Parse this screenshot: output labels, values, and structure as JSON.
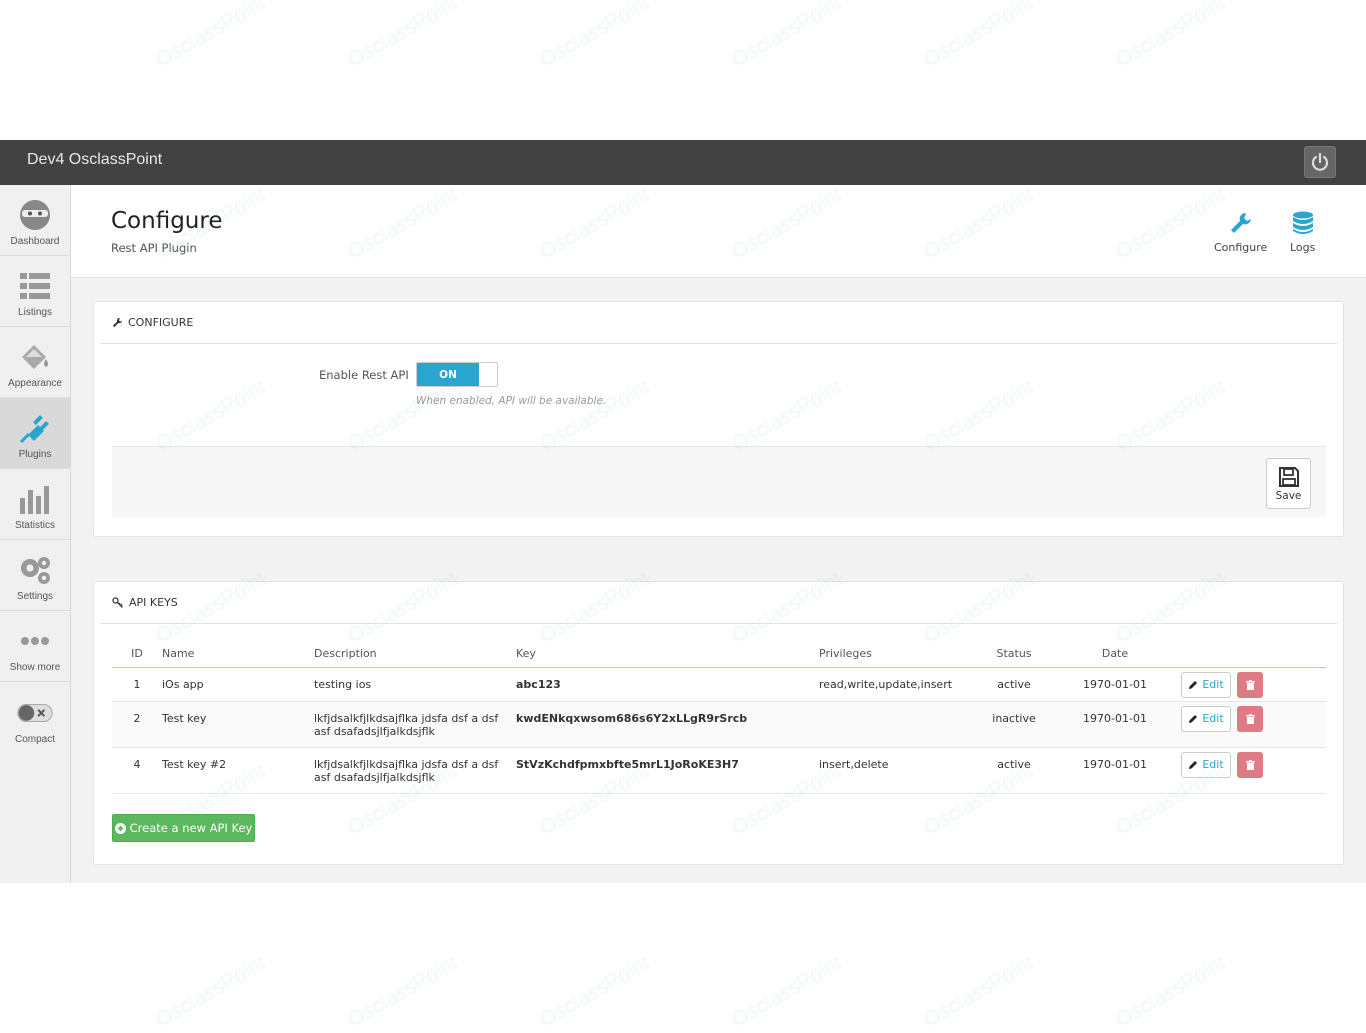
{
  "topbar": {
    "title": "Dev4 OsclassPoint"
  },
  "sidebar": {
    "items": [
      {
        "label": "Dashboard"
      },
      {
        "label": "Listings"
      },
      {
        "label": "Appearance"
      },
      {
        "label": "Plugins"
      },
      {
        "label": "Statistics"
      },
      {
        "label": "Settings"
      },
      {
        "label": "Show more"
      },
      {
        "label": "Compact"
      }
    ]
  },
  "header": {
    "title": "Configure",
    "subtitle": "Rest API Plugin",
    "links": [
      {
        "label": "Configure"
      },
      {
        "label": "Logs"
      }
    ]
  },
  "configure_panel": {
    "heading": "CONFIGURE",
    "enable_label": "Enable Rest API",
    "toggle_state": "ON",
    "hint": "When enabled, API will be available.",
    "save_label": "Save"
  },
  "api_keys_panel": {
    "heading": "API KEYS",
    "columns": [
      "ID",
      "Name",
      "Description",
      "Key",
      "Privileges",
      "Status",
      "Date"
    ],
    "rows": [
      {
        "id": "1",
        "name": "iOs app",
        "description": "testing ios",
        "key": "abc123",
        "privileges": "read,write,update,insert",
        "status": "active",
        "date": "1970-01-01"
      },
      {
        "id": "2",
        "name": "Test key",
        "description": "lkfjdsalkfjlkdsajflka jdsfa dsf a dsf asf dsafadsjlfjalkdsjflk",
        "key": "kwdENkqxwsom686s6Y2xLLgR9rSrcb",
        "privileges": "",
        "status": "inactive",
        "date": "1970-01-01"
      },
      {
        "id": "4",
        "name": "Test key #2",
        "description": "lkfjdsalkfjlkdsajflka jdsfa dsf a dsf asf dsafadsjlfjalkdsjflk",
        "key": "StVzKchdfpmxbfte5mrL1JoRoKE3H7",
        "privileges": "insert,delete",
        "status": "active",
        "date": "1970-01-01"
      }
    ],
    "edit_label": "Edit",
    "create_label": "Create a new API Key"
  },
  "watermark": "OsclassPoint",
  "colors": {
    "accent": "#2aa5d0",
    "topbar": "#424242",
    "success": "#5cb85c",
    "danger": "#e07a85"
  }
}
